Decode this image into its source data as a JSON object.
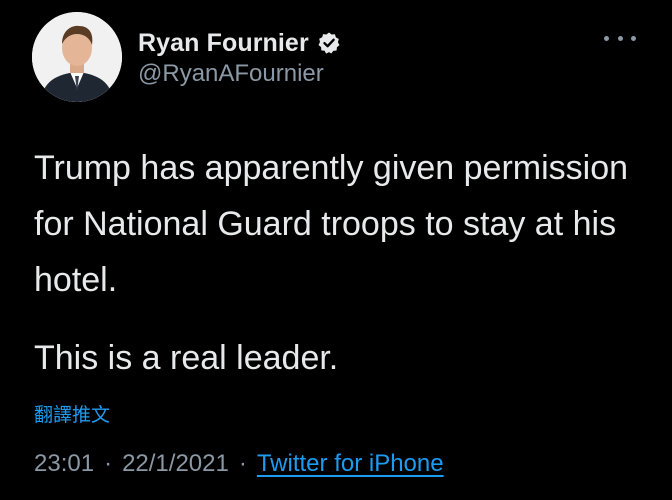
{
  "author": {
    "display_name": "Ryan Fournier",
    "handle": "@RyanAFournier",
    "avatar_icon": "person-photo-icon",
    "verified_icon": "verified-badge-icon"
  },
  "tweet": {
    "paragraphs": [
      "Trump has apparently given permission for National Guard troops to stay at his hotel.",
      "This is a real leader."
    ],
    "translate_label": "翻譯推文",
    "time": "23:01",
    "date": "22/1/2021",
    "separator": "·",
    "source": "Twitter for iPhone"
  },
  "colors": {
    "background": "#000000",
    "text": "#e7e9ea",
    "secondary": "#8b98a5",
    "accent": "#1d9bf0"
  }
}
